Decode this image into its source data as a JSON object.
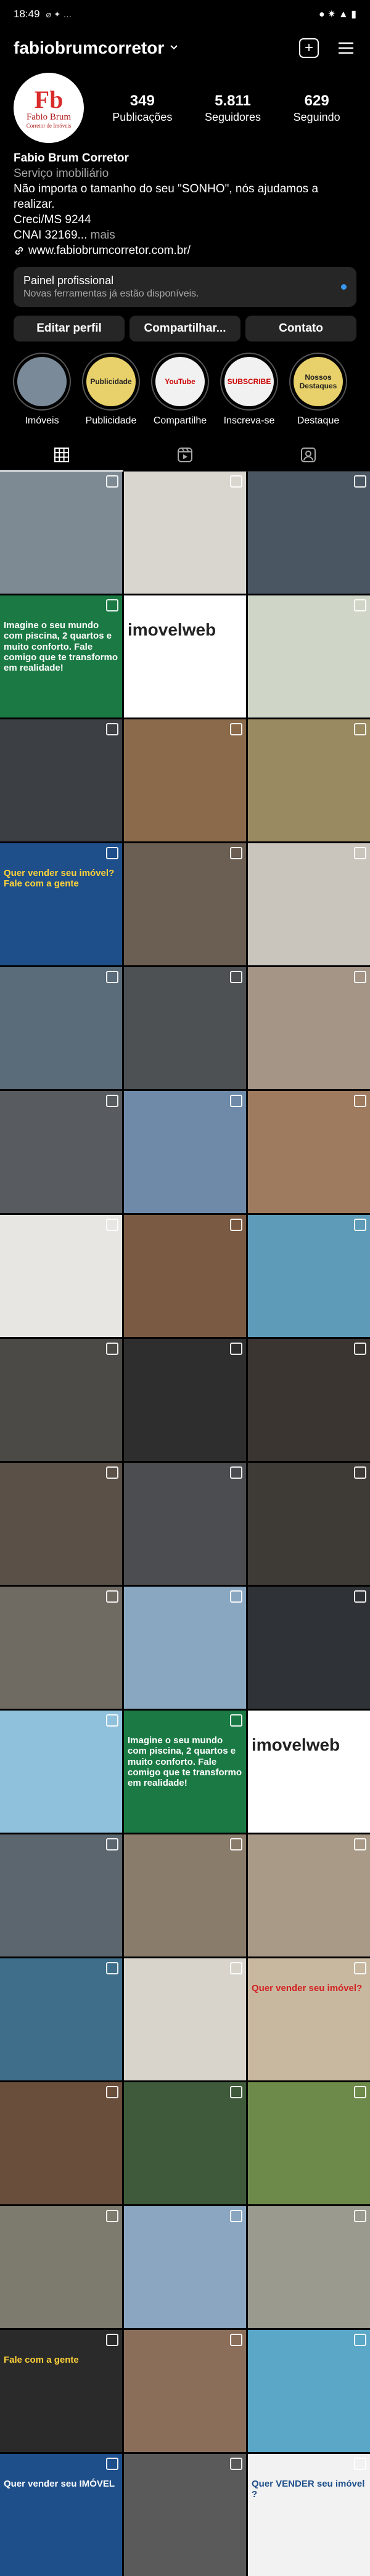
{
  "status": {
    "time": "18:49",
    "icons_left": "⌀ ✦ …",
    "icons_right": "● ✷ ▲ ▮"
  },
  "topbar": {
    "username": "fabiobrumcorretor"
  },
  "profile": {
    "avatar_logo": "Fb",
    "avatar_name": "Fabio Brum",
    "avatar_sub": "Corretor de Imóveis",
    "stats": [
      {
        "num": "349",
        "label": "Publicações"
      },
      {
        "num": "5.811",
        "label": "Seguidores"
      },
      {
        "num": "629",
        "label": "Seguindo"
      }
    ]
  },
  "bio": {
    "name": "Fabio Brum Corretor",
    "category": "Serviço imobiliário",
    "line1": "Não importa o tamanho do seu \"SONHO\", nós ajudamos a realizar.",
    "line2": "Creci/MS 9244",
    "line3": "CNAI 32169...",
    "more": " mais",
    "link": "www.fabiobrumcorretor.com.br/"
  },
  "panel": {
    "title": "Painel profissional",
    "subtitle": "Novas ferramentas já estão disponíveis."
  },
  "actions": [
    "Editar perfil",
    "Compartilhar...",
    "Contato"
  ],
  "highlights": [
    {
      "label": "Imóveis",
      "inner": "",
      "color": "#7a8a99"
    },
    {
      "label": "Publicidade",
      "inner": "Publicidade",
      "color": "#e8d06a"
    },
    {
      "label": "Compartilhe",
      "inner": "YouTube",
      "color": "#f1f1f1"
    },
    {
      "label": "Inscreva-se",
      "inner": "SUBSCRIBE",
      "color": "#f1f1f1"
    },
    {
      "label": "Destaque",
      "inner": "Nossos Destaques",
      "color": "#e8d06a"
    }
  ],
  "grid": {
    "tiles": [
      {
        "color": "#7d8a94"
      },
      {
        "color": "#d9d6cf"
      },
      {
        "color": "#4a5763"
      },
      {
        "color": "#1b7a44",
        "text": "Imagine o seu mundo com piscina, 2 quartos e muito conforto. Fale comigo que te transformo em realidade!",
        "tcolor": "#fff"
      },
      {
        "color": "#ffffff",
        "text": "imovelweb",
        "tcolor": "#222"
      },
      {
        "color": "#cfd6c8"
      },
      {
        "color": "#3c3f44"
      },
      {
        "color": "#8a6a4b"
      },
      {
        "color": "#9a8a62"
      },
      {
        "color": "#1e4f8a",
        "text": "Quer vender seu imóvel? Fale com a gente",
        "tcolor": "#ffd23a"
      },
      {
        "color": "#6b5e52"
      },
      {
        "color": "#c9c4bc"
      },
      {
        "color": "#5a6c7a"
      },
      {
        "color": "#4e5154"
      },
      {
        "color": "#a49586"
      },
      {
        "color": "#585c60"
      },
      {
        "color": "#6e8aa8"
      },
      {
        "color": "#9e7a5e"
      },
      {
        "color": "#e8e6e2"
      },
      {
        "color": "#7a5a42"
      },
      {
        "color": "#5e9bb8"
      },
      {
        "color": "#4c4a46"
      },
      {
        "color": "#2e2e2e"
      },
      {
        "color": "#3a3530"
      },
      {
        "color": "#5a5048"
      },
      {
        "color": "#4b4d50"
      },
      {
        "color": "#3e3a36"
      },
      {
        "color": "#6f6a62"
      },
      {
        "color": "#8aa7c2"
      },
      {
        "color": "#2f3236"
      },
      {
        "color": "#8fc0dc"
      },
      {
        "color": "#1b7a44",
        "text": "Imagine o seu mundo com piscina, 2 quartos e muito conforto. Fale comigo que te transformo em realidade!",
        "tcolor": "#fff"
      },
      {
        "color": "#ffffff",
        "text": "imovelweb",
        "tcolor": "#222"
      },
      {
        "color": "#5c666e"
      },
      {
        "color": "#8a7c6a"
      },
      {
        "color": "#a89a86"
      },
      {
        "color": "#3e6e8a"
      },
      {
        "color": "#d8d4cc"
      },
      {
        "color": "#c8b8a0",
        "text": "Quer vender seu imóvel?",
        "tcolor": "#d32020"
      },
      {
        "color": "#6a4e3c"
      },
      {
        "color": "#3e5a3a"
      },
      {
        "color": "#6e8a4a"
      },
      {
        "color": "#7d7a6e"
      },
      {
        "color": "#8aa6c0"
      },
      {
        "color": "#9a9a8e"
      },
      {
        "color": "#2a2a2a",
        "text": "Fale com a gente",
        "tcolor": "#ffd23a"
      },
      {
        "color": "#8a6e5a"
      },
      {
        "color": "#5aa7c8"
      },
      {
        "color": "#1e4f8a",
        "text": "Quer vender seu IMÓVEL",
        "tcolor": "#fff"
      },
      {
        "color": "#5a5a5a"
      },
      {
        "color": "#f2f2f2",
        "text": "Quer VENDER seu imóvel ?",
        "tcolor": "#1e4f8a"
      }
    ]
  }
}
